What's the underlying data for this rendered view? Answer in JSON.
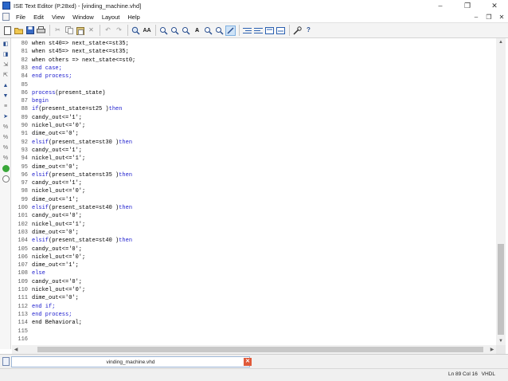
{
  "window": {
    "title": "ISE Text Editor (P.28xd) - [vinding_machine.vhd]",
    "minimize_label": "–",
    "maximize_label": "❐",
    "close_label": "✕"
  },
  "menu": {
    "items": [
      "File",
      "Edit",
      "View",
      "Window",
      "Layout",
      "Help"
    ],
    "child_minimize": "–",
    "child_restore": "❐",
    "child_close": "✕"
  },
  "toolbar": {
    "icons": [
      "new-file",
      "open-folder",
      "save",
      "print",
      "cut",
      "copy",
      "paste",
      "delete",
      "undo",
      "redo",
      "find",
      "find-replace",
      "find-next",
      "find-prev",
      "bookmark",
      "bookmark-next",
      "bookmark-prev",
      "bookmark-clear",
      "search-active",
      "indent",
      "outdent",
      "comment",
      "uncomment",
      "properties",
      "help"
    ]
  },
  "sidebar": {
    "icons": [
      "dock-left",
      "dock-right",
      "expand",
      "collapse",
      "move-up",
      "move-down",
      "format",
      "cursor",
      "edit",
      "tag",
      "tag-edit",
      "tag-remove",
      "go",
      "stop"
    ]
  },
  "editor": {
    "lines": [
      {
        "n": "80",
        "segs": [
          {
            "t": "when st40=> next_state<=st35;",
            "kw": false
          }
        ]
      },
      {
        "n": "81",
        "segs": [
          {
            "t": "when st45=> next_state<=st35;",
            "kw": false
          }
        ]
      },
      {
        "n": "82",
        "segs": [
          {
            "t": "when others => next_state<=st0;",
            "kw": false
          }
        ]
      },
      {
        "n": "83",
        "segs": [
          {
            "t": "end case;",
            "kw": true
          }
        ]
      },
      {
        "n": "84",
        "segs": [
          {
            "t": "end process;",
            "kw": true
          }
        ]
      },
      {
        "n": "85",
        "segs": []
      },
      {
        "n": "86",
        "segs": [
          {
            "t": "process",
            "kw": true
          },
          {
            "t": "(present_state)",
            "kw": false
          }
        ]
      },
      {
        "n": "87",
        "segs": [
          {
            "t": "begin",
            "kw": true
          }
        ]
      },
      {
        "n": "88",
        "segs": [
          {
            "t": "if",
            "kw": true
          },
          {
            "t": "(present_state=st25 )",
            "kw": false
          },
          {
            "t": "then",
            "kw": true
          }
        ]
      },
      {
        "n": "89",
        "segs": [
          {
            "t": "candy_out<='1';",
            "kw": false
          }
        ]
      },
      {
        "n": "90",
        "segs": [
          {
            "t": "nickel_out<='0';",
            "kw": false
          }
        ]
      },
      {
        "n": "91",
        "segs": [
          {
            "t": "dime_out<='0';",
            "kw": false
          }
        ]
      },
      {
        "n": "92",
        "segs": [
          {
            "t": "elsif",
            "kw": true
          },
          {
            "t": "(present_state=st30 )",
            "kw": false
          },
          {
            "t": "then",
            "kw": true
          }
        ]
      },
      {
        "n": "93",
        "segs": [
          {
            "t": "candy_out<='1';",
            "kw": false
          }
        ]
      },
      {
        "n": "94",
        "segs": [
          {
            "t": "nickel_out<='1';",
            "kw": false
          }
        ]
      },
      {
        "n": "95",
        "segs": [
          {
            "t": "dime_out<='0';",
            "kw": false
          }
        ]
      },
      {
        "n": "96",
        "segs": [
          {
            "t": "elsif",
            "kw": true
          },
          {
            "t": "(present_state=st35 )",
            "kw": false
          },
          {
            "t": "then",
            "kw": true
          }
        ]
      },
      {
        "n": "97",
        "segs": [
          {
            "t": "candy_out<='1';",
            "kw": false
          }
        ]
      },
      {
        "n": "98",
        "segs": [
          {
            "t": "nickel_out<='0';",
            "kw": false
          }
        ]
      },
      {
        "n": "99",
        "segs": [
          {
            "t": "dime_out<='1';",
            "kw": false
          }
        ]
      },
      {
        "n": "100",
        "segs": [
          {
            "t": "elsif",
            "kw": true
          },
          {
            "t": "(present_state=st40 )",
            "kw": false
          },
          {
            "t": "then",
            "kw": true
          }
        ]
      },
      {
        "n": "101",
        "segs": [
          {
            "t": "candy_out<='0';",
            "kw": false
          }
        ]
      },
      {
        "n": "102",
        "segs": [
          {
            "t": "nickel_out<='1';",
            "kw": false
          }
        ]
      },
      {
        "n": "103",
        "segs": [
          {
            "t": "dime_out<='0';",
            "kw": false
          }
        ]
      },
      {
        "n": "104",
        "segs": [
          {
            "t": "elsif",
            "kw": true
          },
          {
            "t": "(present_state=st40 )",
            "kw": false
          },
          {
            "t": "then",
            "kw": true
          }
        ]
      },
      {
        "n": "105",
        "segs": [
          {
            "t": "candy_out<='0';",
            "kw": false
          }
        ]
      },
      {
        "n": "106",
        "segs": [
          {
            "t": "nickel_out<='0';",
            "kw": false
          }
        ]
      },
      {
        "n": "107",
        "segs": [
          {
            "t": "dime_out<='1';",
            "kw": false
          }
        ]
      },
      {
        "n": "108",
        "segs": [
          {
            "t": "else",
            "kw": true
          }
        ]
      },
      {
        "n": "109",
        "segs": [
          {
            "t": "candy_out<='0';",
            "kw": false
          }
        ]
      },
      {
        "n": "110",
        "segs": [
          {
            "t": "nickel_out<='0';",
            "kw": false
          }
        ]
      },
      {
        "n": "111",
        "segs": [
          {
            "t": "dime_out<='0';",
            "kw": false
          }
        ]
      },
      {
        "n": "112",
        "segs": [
          {
            "t": "end if;",
            "kw": true
          }
        ]
      },
      {
        "n": "113",
        "segs": [
          {
            "t": "end process;",
            "kw": true
          }
        ]
      },
      {
        "n": "114",
        "segs": [
          {
            "t": "end Behavioral;",
            "kw": false
          }
        ]
      },
      {
        "n": "115",
        "segs": []
      },
      {
        "n": "116",
        "segs": []
      }
    ],
    "keyword_color": "#1a1acd"
  },
  "tab": {
    "label": "vinding_machine.vhd",
    "close_label": "✕"
  },
  "status": {
    "position": "Ln 89 Col 16",
    "language": "VHDL"
  }
}
